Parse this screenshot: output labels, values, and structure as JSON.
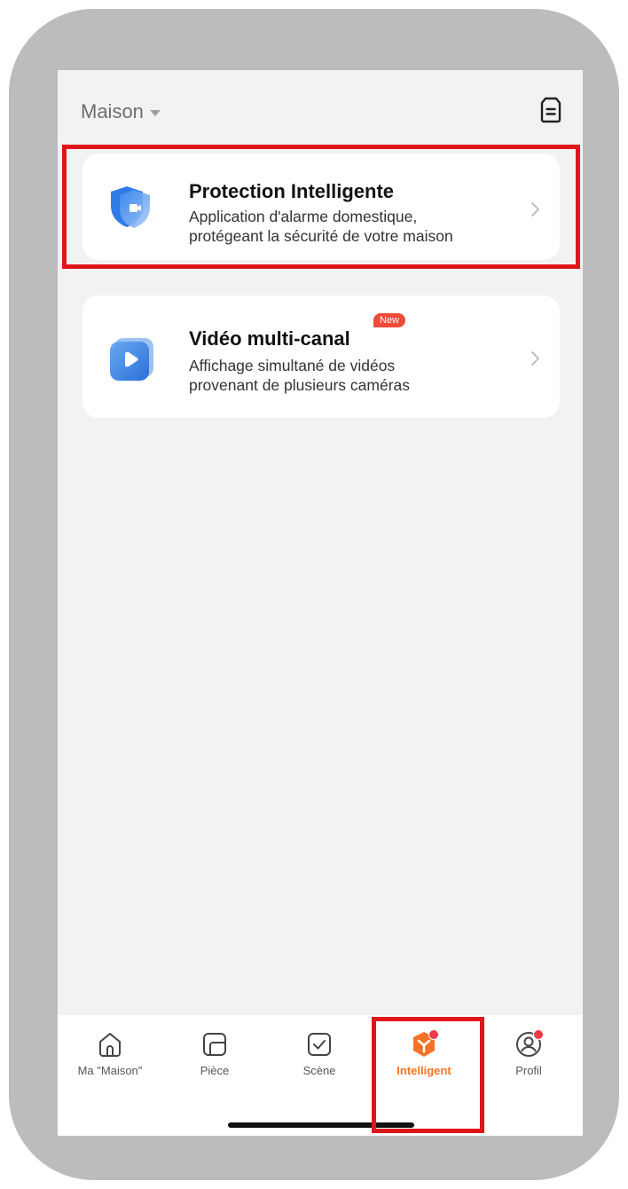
{
  "header": {
    "home_label": "Maison"
  },
  "cards": [
    {
      "title": "Protection Intelligente",
      "desc_line1": "Application d'alarme domestique,",
      "desc_line2": "protégeant la sécurité de votre maison",
      "icon": "shield-camera-icon"
    },
    {
      "title": "Vidéo multi-canal",
      "badge": "New",
      "desc_line1": "Affichage simultané de vidéos",
      "desc_line2": "provenant de plusieurs caméras",
      "icon": "video-play-icon"
    }
  ],
  "tabs": [
    {
      "label": "Ma \"Maison\"",
      "icon": "house-icon"
    },
    {
      "label": "Pièce",
      "icon": "room-icon"
    },
    {
      "label": "Scène",
      "icon": "scene-check-icon"
    },
    {
      "label": "Intelligent",
      "icon": "intelligent-icon",
      "active": true
    },
    {
      "label": "Profil",
      "icon": "profile-icon"
    }
  ],
  "colors": {
    "accent": "#f47326",
    "highlight": "#e0151a",
    "badge": "#ef4a3a"
  }
}
